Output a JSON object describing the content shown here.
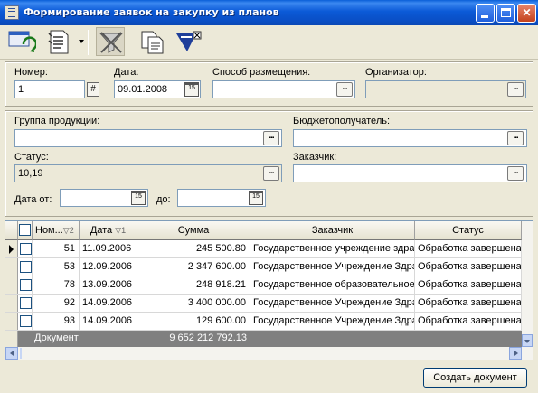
{
  "window": {
    "title": "Формирование заявок на закупку из планов"
  },
  "form": {
    "number_label": "Номер:",
    "number_value": "1",
    "date_label": "Дата:",
    "date_value": "09.01.2008",
    "method_label": "Способ размещения:",
    "method_value": "",
    "organizer_label": "Организатор:",
    "organizer_value": "",
    "product_group_label": "Группа продукции:",
    "product_group_value": "",
    "budget_recipient_label": "Бюджетополучатель:",
    "budget_recipient_value": "",
    "status_label": "Статус:",
    "status_value": "10,19",
    "customer_label": "Заказчик:",
    "customer_value": "",
    "date_from_label": "Дата от:",
    "date_from_value": "",
    "date_to_label": "до:",
    "date_to_value": "",
    "dots": "..."
  },
  "grid": {
    "columns": [
      "Ном...",
      "Дата",
      "Сумма",
      "Заказчик",
      "Статус"
    ],
    "sort_marks": [
      "▽2",
      "▽1"
    ],
    "rows": [
      {
        "num": "51",
        "date": "11.09.2006",
        "sum": "245 500.80",
        "customer": "Государственное учреждение здра",
        "status": "Обработка завершена"
      },
      {
        "num": "53",
        "date": "12.09.2006",
        "sum": "2 347 600.00",
        "customer": "Государственное Учреждение Здра",
        "status": "Обработка завершена"
      },
      {
        "num": "78",
        "date": "13.09.2006",
        "sum": "248 918.21",
        "customer": "Государственное образовательное",
        "status": "Обработка завершена"
      },
      {
        "num": "92",
        "date": "14.09.2006",
        "sum": "3 400 000.00",
        "customer": "Государственное Учреждение Здра",
        "status": "Обработка завершена"
      },
      {
        "num": "93",
        "date": "14.09.2006",
        "sum": "129 600.00",
        "customer": "Государственное Учреждение Здра",
        "status": "Обработка завершена"
      }
    ],
    "footer_label": "Документ",
    "footer_total": "9 652 212 792.13"
  },
  "actions": {
    "create_document": "Создать документ"
  }
}
